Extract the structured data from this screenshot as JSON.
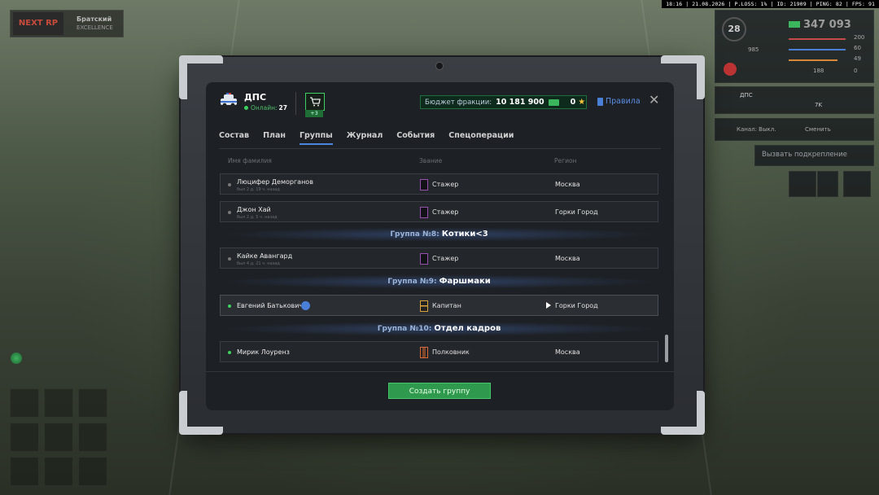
{
  "topbar": {
    "text": "18:16 | 21.08.2026 | P.LOSS: 1% | ID: 21909 | PING: 82 | FPS: 91"
  },
  "logo": {
    "mark": "NEXT RP",
    "server": "Братский",
    "sub": "EXCELLENCE"
  },
  "hud": {
    "level": "28",
    "money": "347 093",
    "stat_hp": "200",
    "stat_armor": "60",
    "stat_food": "49",
    "stat_other": "0",
    "stat_misc": "985",
    "stat_ammo": "188",
    "player_name": "ДПС",
    "call_support": "Вызвать подкрепление",
    "channel": "Канал: Выкл.",
    "switch": "Сменить",
    "badge_7k": "7K"
  },
  "faction": {
    "name": "ДПС",
    "online_label": "Онлайн:",
    "online_count": "27",
    "shop_badge": "+3",
    "budget_label": "Бюджет фракции:",
    "budget_value": "10 181 900",
    "coins": "0",
    "rules": "Правила"
  },
  "tabs": [
    "Состав",
    "План",
    "Группы",
    "Журнал",
    "События",
    "Спецоперации"
  ],
  "columns": {
    "name": "Имя фамилия",
    "rank": "Звание",
    "region": "Регион"
  },
  "rows": [
    {
      "name": "Люцифер Деморганов",
      "sub": "был 2 д. 19 ч. назад",
      "rank": "Стажер",
      "region": "Москва"
    },
    {
      "name": "Джон Хай",
      "sub": "был 2 д. 5 ч. назад",
      "rank": "Стажер",
      "region": "Горки Город"
    },
    {
      "name": "Кайке Авангард",
      "sub": "был 4 д. 21 ч. назад",
      "rank": "Стажер",
      "region": "Москва"
    },
    {
      "name": "Евгений Батькович",
      "rank": "Капитан",
      "region": "Горки Город"
    },
    {
      "name": "Мирик Лоуренз",
      "rank": "Полковник",
      "region": "Москва"
    }
  ],
  "groups": [
    {
      "label": "Группа №8:",
      "name": "Котики<3"
    },
    {
      "label": "Группа №9:",
      "name": "Фаршмаки"
    },
    {
      "label": "Группа №10:",
      "name": "Отдел кадров"
    }
  ],
  "create_button": "Создать группу"
}
